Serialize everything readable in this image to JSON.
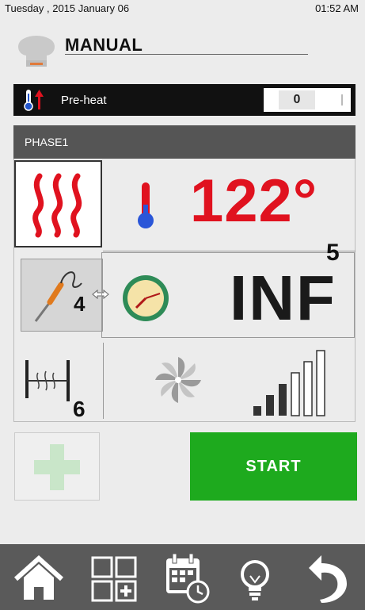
{
  "status": {
    "date": "Tuesday , 2015 January 06",
    "time": "01:52 AM"
  },
  "header": {
    "title": "MANUAL"
  },
  "preheat": {
    "label": "Pre-heat",
    "value": "0"
  },
  "phase": {
    "label": "PHASE1",
    "temperature": "122°",
    "time": "INF",
    "badge_time": "5",
    "badge_probe": "4",
    "badge_damper": "6",
    "fan_level_fraction": 0.4
  },
  "actions": {
    "start_label": "START"
  },
  "colors": {
    "accent_red": "#e0121f",
    "start_green": "#1eaa1e",
    "add_green": "#c9e6c9",
    "footer": "#5a5a5a"
  },
  "icons": [
    "chef-hat-icon",
    "thermometer-heat-icon",
    "heat-waves-icon",
    "thermometer-icon",
    "probe-icon",
    "arrows-icon",
    "clock-icon",
    "damper-icon",
    "fan-icon",
    "fan-level-icon",
    "plus-icon",
    "home-icon",
    "grid-add-icon",
    "calendar-clock-icon",
    "bulb-icon",
    "back-icon"
  ]
}
